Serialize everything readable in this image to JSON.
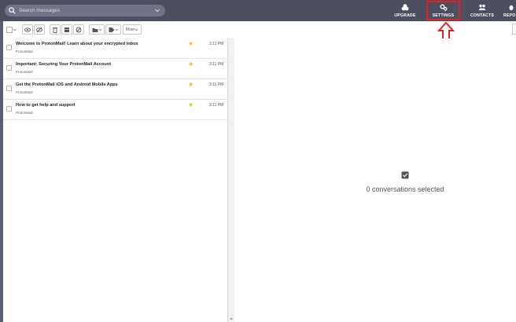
{
  "search": {
    "placeholder": "Search messages"
  },
  "nav": {
    "upgrade": "UPGRADE",
    "settings": "SETTINGS",
    "contacts": "CONTACTS",
    "reports": "REPO"
  },
  "toolbar": {
    "more_label": "More"
  },
  "messages": [
    {
      "subject": "Welcome to ProtonMail! Learn about your encrypted inbox",
      "sender": "ProtonMail",
      "time": "3:11 PM",
      "starred": true
    },
    {
      "subject": "Important: Securing Your ProtonMail Account",
      "sender": "ProtonMail",
      "time": "3:11 PM",
      "starred": true
    },
    {
      "subject": "Get the ProtonMail iOS and Android Mobile Apps",
      "sender": "ProtonMail",
      "time": "3:11 PM",
      "starred": true
    },
    {
      "subject": "How to get help and support",
      "sender": "ProtonMail",
      "time": "3:11 PM",
      "starred": true
    }
  ],
  "reading_pane": {
    "status": "0 conversations selected"
  },
  "colors": {
    "topbar": "#4c4f60",
    "highlight": "#e02222",
    "star": "#e8c22b"
  }
}
